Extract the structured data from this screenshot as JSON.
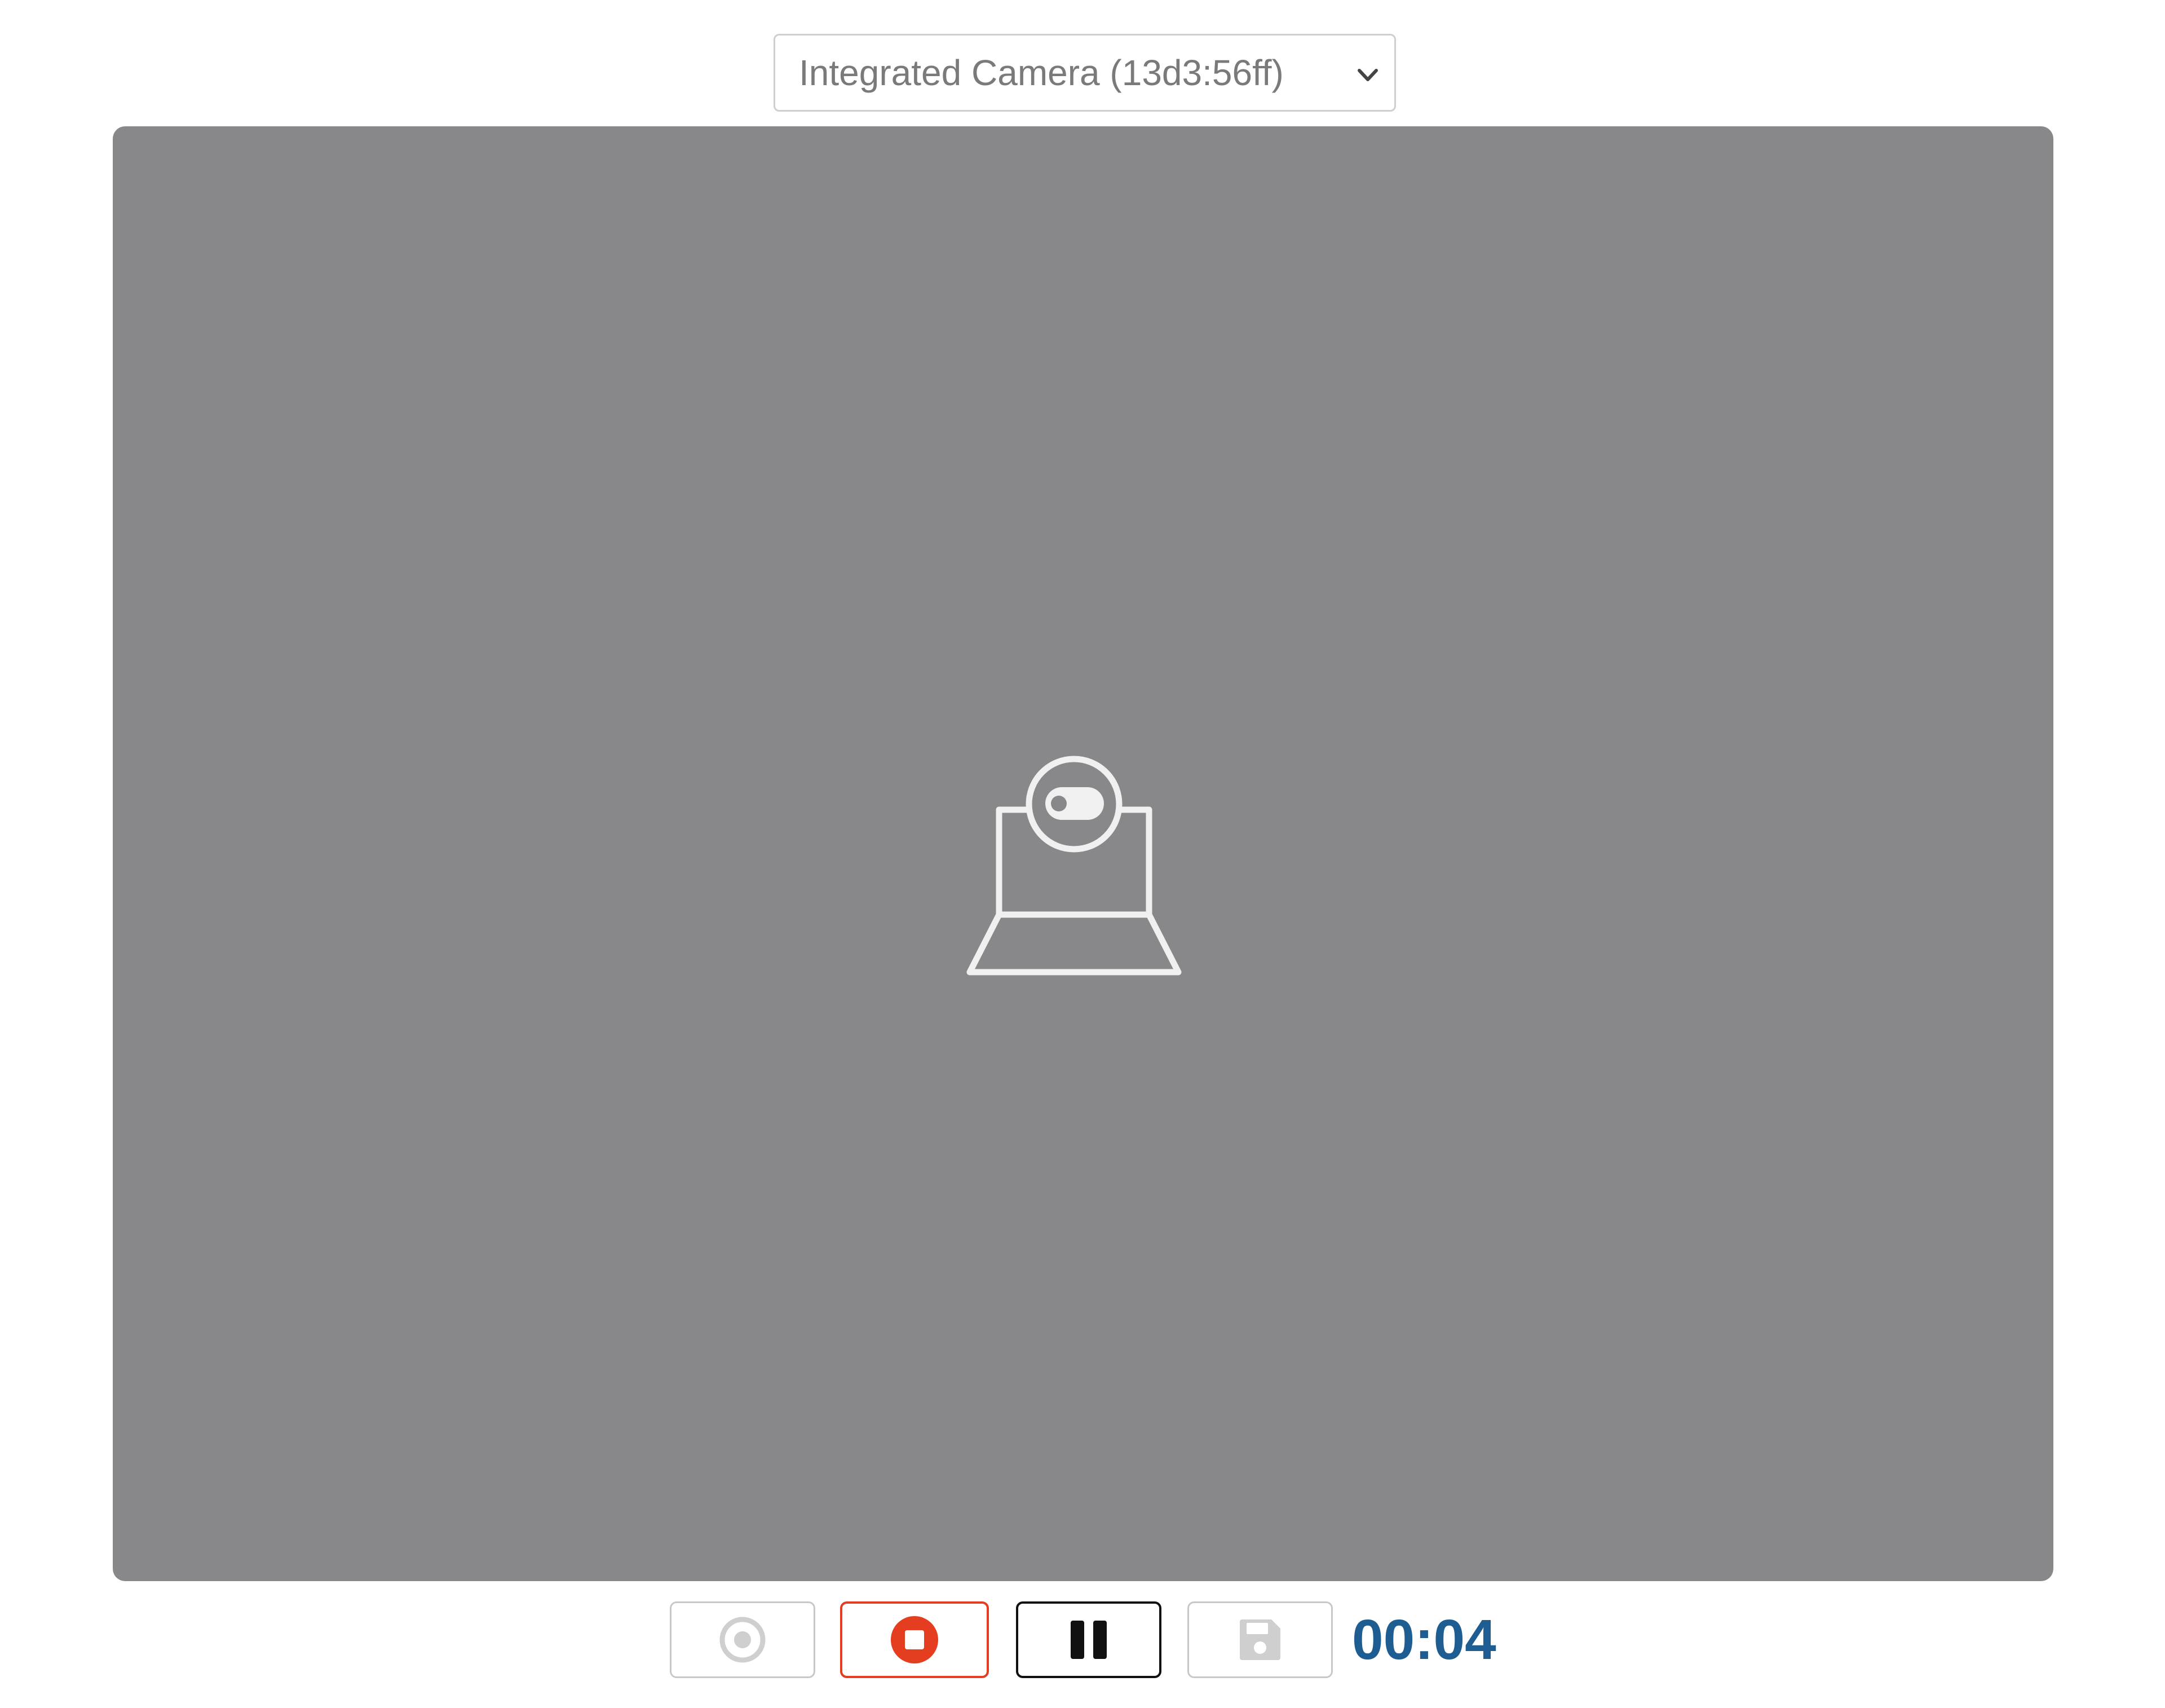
{
  "camera_select": {
    "selected_label": "Integrated Camera (13d3:56ff)",
    "chevron_icon": "chevron-down-icon"
  },
  "preview": {
    "background_color": "#88888a",
    "placeholder_icon": "webcam-icon"
  },
  "controls": {
    "snapshot": {
      "icon": "camera-shutter-icon",
      "state": "disabled"
    },
    "stop": {
      "icon": "stop-icon",
      "color": "#e53d1f"
    },
    "pause": {
      "icon": "pause-icon",
      "color": "#111111"
    },
    "save": {
      "icon": "floppy-disk-icon",
      "state": "disabled"
    },
    "timer": "00:04",
    "timer_color": "#1d5d91"
  }
}
